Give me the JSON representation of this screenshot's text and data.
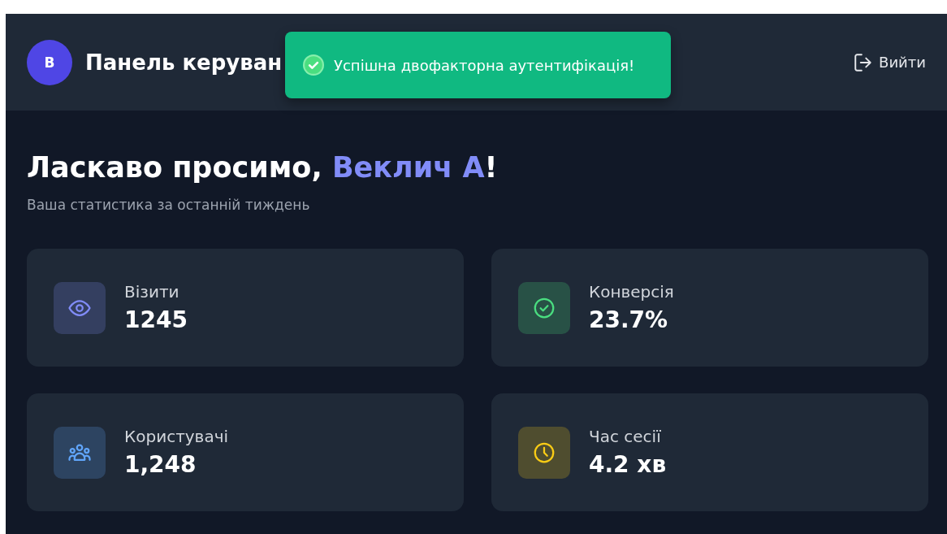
{
  "header": {
    "avatar": "В",
    "title": "Панель керуван",
    "logout": "Вийти"
  },
  "toast": {
    "message": "Успішна двофакторна аутентифікація!"
  },
  "welcome": {
    "greeting": "Ласкаво просимо, **Веклич А**!",
    "subtitle": "Ваша статистика за останній тиждень"
  },
  "stats": [
    {
      "label": "Візити",
      "value": "1245",
      "color": "#818cf8"
    },
    {
      "label": "Конверсія",
      "value": "23.7%",
      "color": "#4ade80"
    },
    {
      "label": "Користувачі",
      "value": "1,248",
      "color": "#60a5fa"
    },
    {
      "label": "Час сесії",
      "value": "4.2 хв",
      "color": "#facc15"
    }
  ]
}
